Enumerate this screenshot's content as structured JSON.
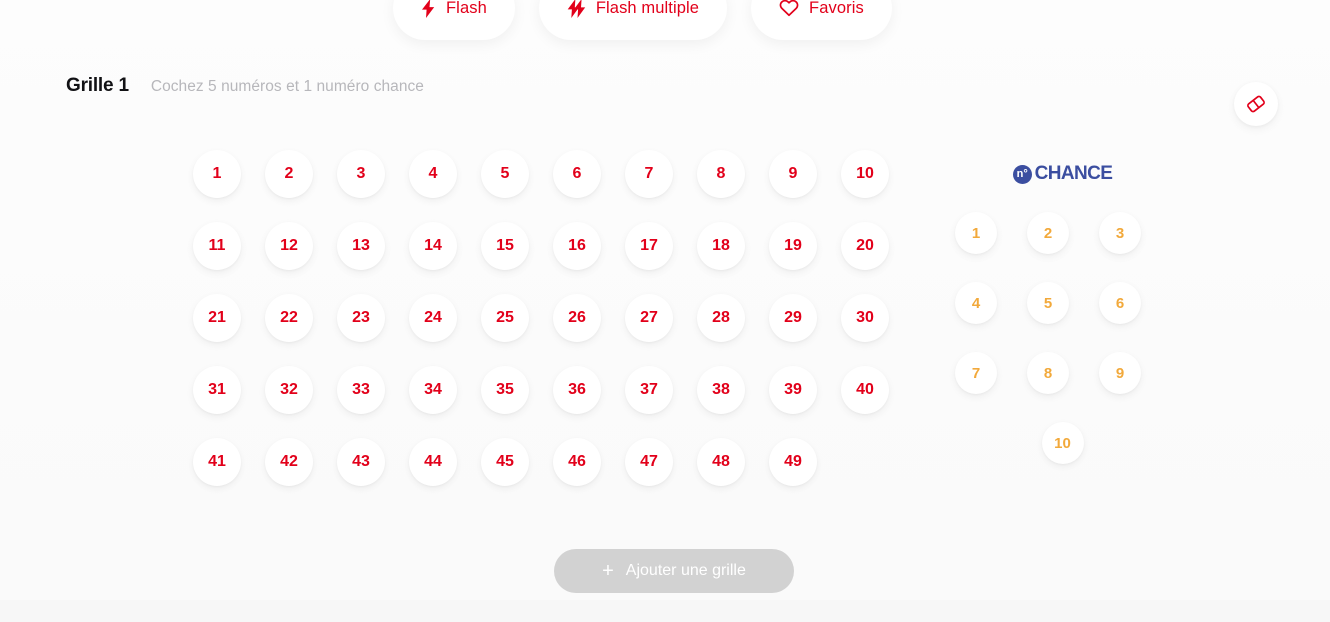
{
  "actions": [
    {
      "id": "flash",
      "label": "Flash",
      "icon": "lightning-bolt-icon"
    },
    {
      "id": "flash-multiple",
      "label": "Flash multiple",
      "icon": "double-lightning-bolt-icon"
    },
    {
      "id": "favoris",
      "label": "Favoris",
      "icon": "heart-outline-icon"
    }
  ],
  "grid": {
    "title": "Grille 1",
    "hint": "Cochez 5 numéros et 1 numéro chance",
    "eraser_icon": "eraser-icon",
    "rows": [
      [
        "1",
        "2",
        "3",
        "4",
        "5",
        "6",
        "7",
        "8",
        "9",
        "10"
      ],
      [
        "11",
        "12",
        "13",
        "14",
        "15",
        "16",
        "17",
        "18",
        "19",
        "20"
      ],
      [
        "21",
        "22",
        "23",
        "24",
        "25",
        "26",
        "27",
        "28",
        "29",
        "30"
      ],
      [
        "31",
        "32",
        "33",
        "34",
        "35",
        "36",
        "37",
        "38",
        "39",
        "40"
      ],
      [
        "41",
        "42",
        "43",
        "44",
        "45",
        "46",
        "47",
        "48",
        "49"
      ]
    ]
  },
  "chance": {
    "logo_badge": "n°",
    "logo_word": "CHANCE",
    "rows": [
      [
        "1",
        "2",
        "3"
      ],
      [
        "4",
        "5",
        "6"
      ],
      [
        "7",
        "8",
        "9"
      ],
      [
        "10"
      ]
    ]
  },
  "add_grid": {
    "label": "Ajouter une grille",
    "plus_icon": "plus-icon",
    "plus_glyph": "+"
  },
  "colors": {
    "red": "#e2001a",
    "orange": "#f2a93b",
    "blue": "#3b4ea0",
    "disabled_gray": "#d2d2d2",
    "hint_gray": "#b7b7bb",
    "background": "#fbfbfb"
  }
}
